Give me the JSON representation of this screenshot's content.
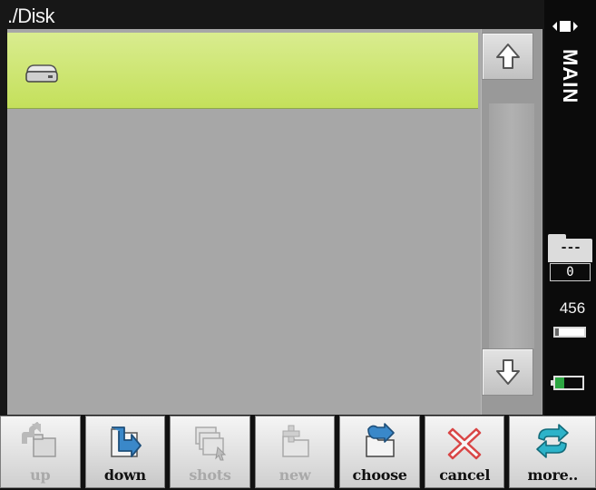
{
  "path": "./Disk",
  "file_list": {
    "items": [
      {
        "icon": "drive-icon",
        "label": ""
      }
    ]
  },
  "scroll": {
    "up_icon": "arrow-up-icon",
    "down_icon": "arrow-down-icon"
  },
  "status": {
    "mode": "MAIN",
    "folder_marker": "---",
    "folder_count": "0",
    "memory": "456",
    "memory_level": 0.12,
    "battery_level": 0.32
  },
  "toolbar": [
    {
      "id": "up",
      "label": "up",
      "icon": "folder-up-icon",
      "enabled": false
    },
    {
      "id": "down",
      "label": "down",
      "icon": "folder-down-icon",
      "enabled": true
    },
    {
      "id": "shots",
      "label": "shots",
      "icon": "screenshots-icon",
      "enabled": false
    },
    {
      "id": "new",
      "label": "new",
      "icon": "new-folder-icon",
      "enabled": false
    },
    {
      "id": "choose",
      "label": "choose",
      "icon": "choose-icon",
      "enabled": true
    },
    {
      "id": "cancel",
      "label": "cancel",
      "icon": "cancel-x-icon",
      "enabled": true
    },
    {
      "id": "more",
      "label": "more..",
      "icon": "more-arrows-icon",
      "enabled": true
    }
  ],
  "colors": {
    "selection": "#c8e06a",
    "panel": "#a7a7a7",
    "battery": "#2da642",
    "arrow_blue": "#3a88c9"
  }
}
